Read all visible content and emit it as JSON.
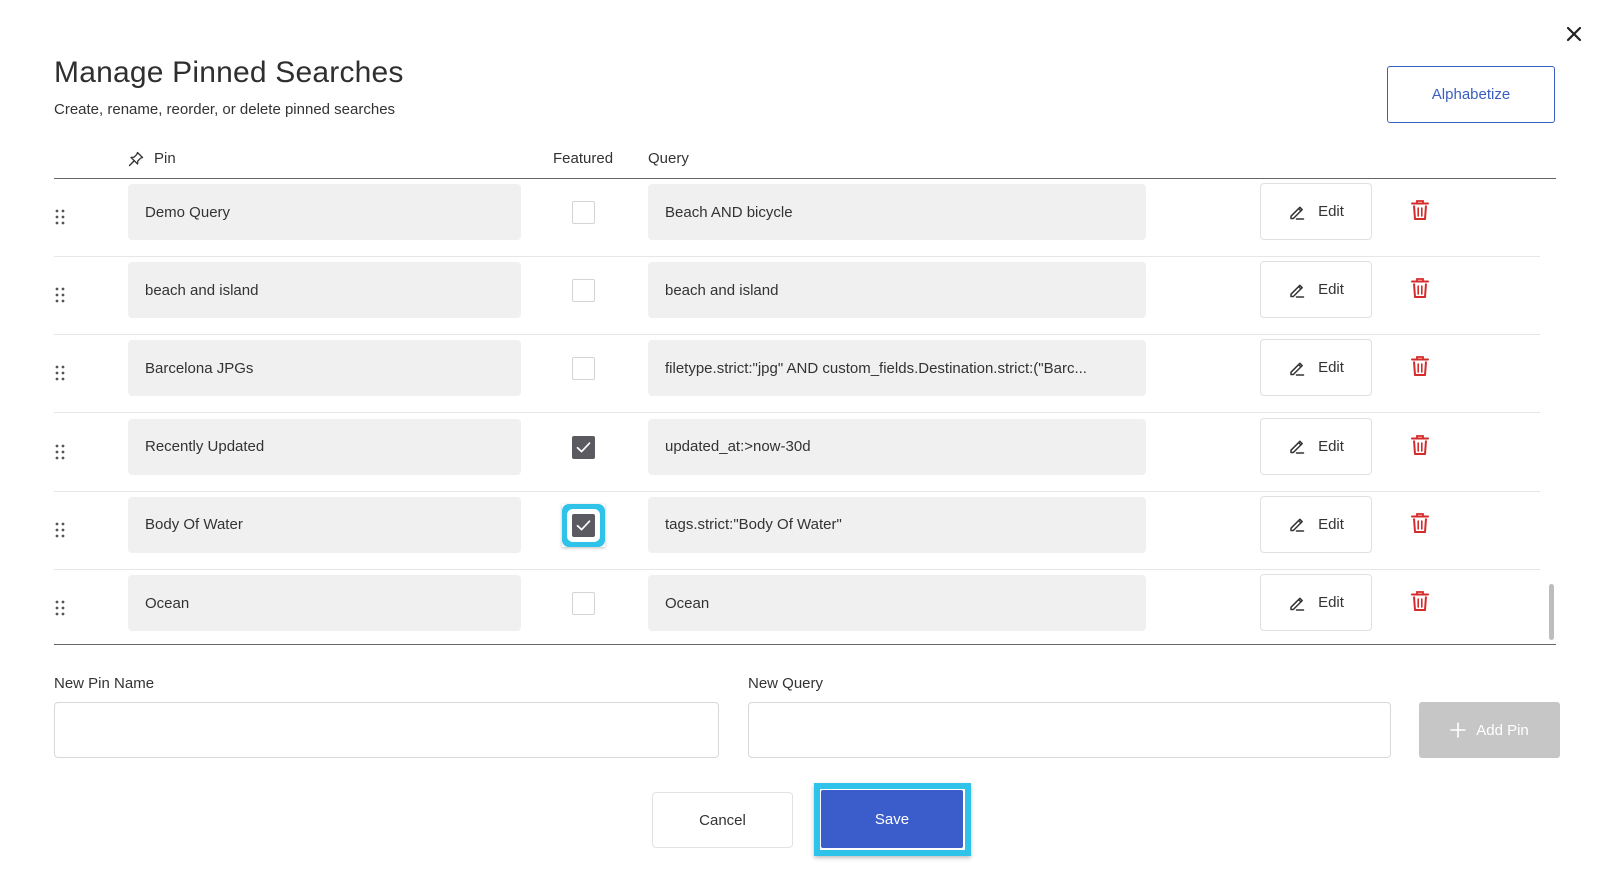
{
  "dialog": {
    "title": "Manage Pinned Searches",
    "subtitle": "Create, rename, reorder, or delete pinned searches",
    "close_icon": "close-icon",
    "alphabetize_label": "Alphabetize"
  },
  "table": {
    "headers": {
      "pin": "Pin",
      "featured": "Featured",
      "query": "Query"
    },
    "pin_header_icon": "pin-icon",
    "rows": [
      {
        "name": "Demo Query",
        "featured": false,
        "query": "Beach AND bicycle",
        "edit_label": "Edit"
      },
      {
        "name": "beach and island",
        "featured": false,
        "query": "beach and island",
        "edit_label": "Edit"
      },
      {
        "name": "Barcelona JPGs",
        "featured": false,
        "query": "filetype.strict:\"jpg\" AND custom_fields.Destination.strict:(\"Barc...",
        "edit_label": "Edit"
      },
      {
        "name": "Recently Updated",
        "featured": true,
        "query": "updated_at:>now-30d",
        "edit_label": "Edit"
      },
      {
        "name": "Body Of Water",
        "featured": true,
        "query": "tags.strict:\"Body Of Water\"",
        "edit_label": "Edit"
      },
      {
        "name": "Ocean",
        "featured": false,
        "query": "Ocean",
        "edit_label": "Edit"
      }
    ],
    "row_icons": {
      "drag": "drag-handle-icon",
      "edit": "pencil-icon",
      "delete": "trash-icon"
    }
  },
  "new_pin": {
    "name_label": "New Pin Name",
    "name_value": "",
    "query_label": "New Query",
    "query_value": "",
    "add_label": "Add Pin",
    "add_icon": "plus-icon"
  },
  "footer": {
    "cancel_label": "Cancel",
    "save_label": "Save"
  },
  "colors": {
    "accent": "#3b5dcb",
    "highlight": "#2fc3ea",
    "delete": "#d62b2b",
    "disabled": "#c6c6c6"
  }
}
